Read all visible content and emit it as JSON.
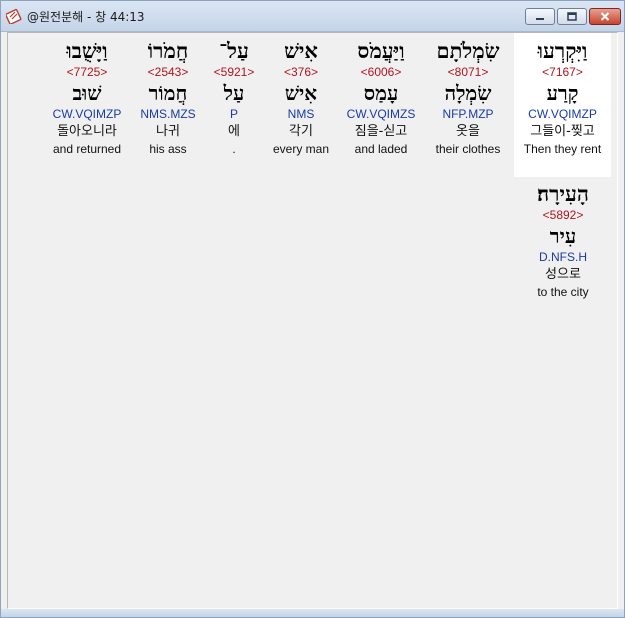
{
  "window": {
    "title": "@원전분해 - 창 44:13",
    "controls": {
      "minimize": "minimize",
      "maximize": "maximize",
      "close": "close"
    }
  },
  "icons": {
    "app": "bible-app-icon",
    "minimize": "minimize-icon",
    "maximize": "maximize-icon",
    "close": "close-icon"
  },
  "colors": {
    "strong_number": "#b0141e",
    "parsing": "#1a3aa8",
    "highlight_bg": "#ffffff"
  },
  "words": [
    {
      "hebrew": "וַיִּקְרְעוּ",
      "strong": "<7167>",
      "lemma": "קָרַע",
      "parsing": "CW.VQIMZP",
      "korean": "그들이-찢고",
      "english": "Then they rent",
      "highlighted": true
    },
    {
      "hebrew": "שִׂמְלֹתָם",
      "strong": "<8071>",
      "lemma": "שִׂמְלָה",
      "parsing": "NFP.MZP",
      "korean": "옷을",
      "english": "their clothes",
      "highlighted": false
    },
    {
      "hebrew": "וַיַּעֲמֹס",
      "strong": "<6006>",
      "lemma": "עָמַס",
      "parsing": "CW.VQIMZS",
      "korean": "짐을-싣고",
      "english": "and laded",
      "highlighted": false
    },
    {
      "hebrew": "אִישׁ",
      "strong": "<376>",
      "lemma": "אִישׁ",
      "parsing": "NMS",
      "korean": "각기",
      "english": "every man",
      "highlighted": false
    },
    {
      "hebrew": "עַל־",
      "strong": "<5921>",
      "lemma": "עַל",
      "parsing": "P",
      "korean": "에",
      "english": ".",
      "highlighted": false
    },
    {
      "hebrew": "חֲמֹרוֹ",
      "strong": "<2543>",
      "lemma": "חֲמוֹר",
      "parsing": "NMS.MZS",
      "korean": "나귀",
      "english": "his ass",
      "highlighted": false
    },
    {
      "hebrew": "וַיָּשֻׁבוּ",
      "strong": "<7725>",
      "lemma": "שׁוּב",
      "parsing": "CW.VQIMZP",
      "korean": "돌아오니라",
      "english": "and returned",
      "highlighted": false
    },
    {
      "hebrew": "הָעִירָה׃",
      "strong": "<5892>",
      "lemma": "עִיר",
      "parsing": "D.NFS.H",
      "korean": "성으로",
      "english": "to the city",
      "highlighted": false
    }
  ]
}
